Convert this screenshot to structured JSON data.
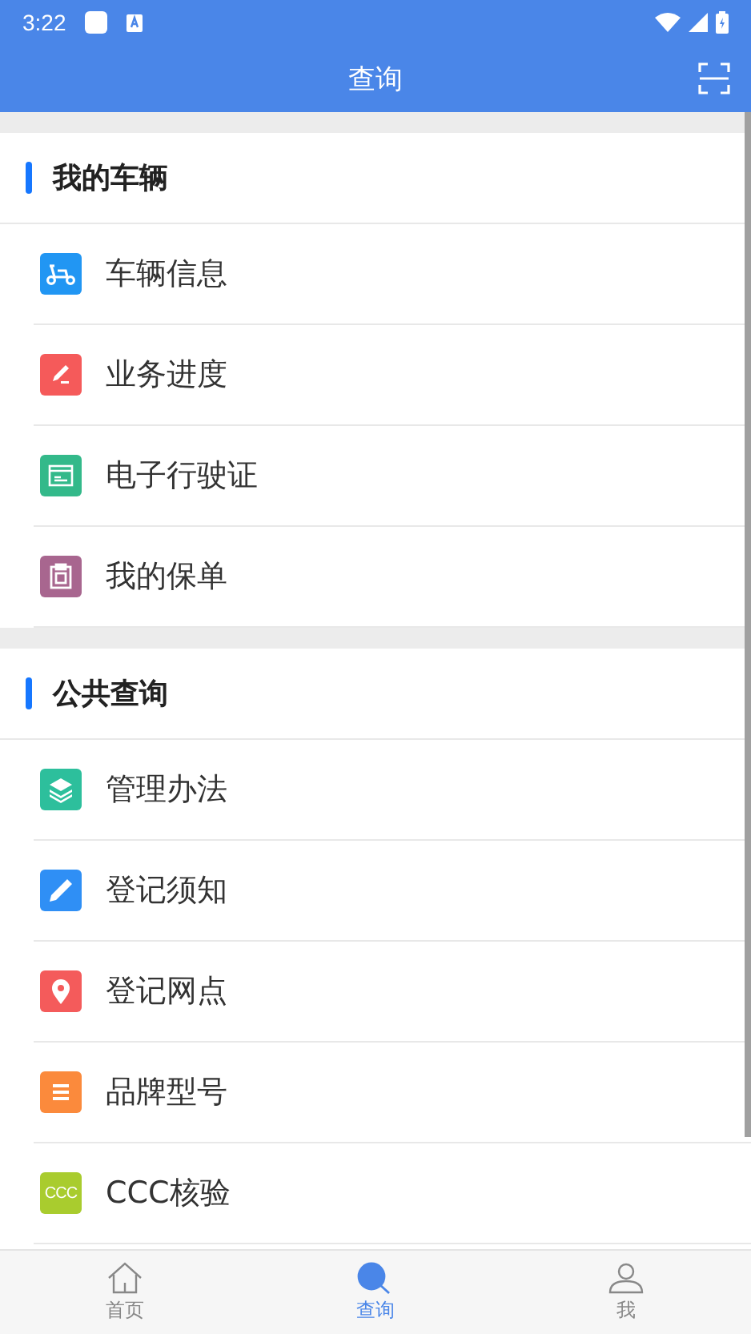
{
  "status_bar": {
    "time": "3:22"
  },
  "header": {
    "title": "查询"
  },
  "sections": [
    {
      "title": "我的车辆",
      "items": [
        {
          "label": "车辆信息",
          "kind": "scooter",
          "color": "#2196f3"
        },
        {
          "label": "业务进度",
          "kind": "pen",
          "color": "#f55a5a"
        },
        {
          "label": "电子行驶证",
          "kind": "card",
          "color": "#33b98a"
        },
        {
          "label": "我的保单",
          "kind": "clipboard",
          "color": "#a8668f"
        }
      ]
    },
    {
      "title": "公共查询",
      "items": [
        {
          "label": "管理办法",
          "kind": "layers",
          "color": "#2dbf9c"
        },
        {
          "label": "登记须知",
          "kind": "pencil",
          "color": "#2f8ff5"
        },
        {
          "label": "登记网点",
          "kind": "pin",
          "color": "#f45b5b"
        },
        {
          "label": "品牌型号",
          "kind": "list",
          "color": "#fb8a3c"
        },
        {
          "label": "CCC核验",
          "kind": "text",
          "icon_text": "CCC",
          "color": "#a9cc2e"
        }
      ]
    }
  ],
  "tabs": [
    {
      "label": "首页",
      "kind": "home",
      "selected": false
    },
    {
      "label": "查询",
      "kind": "search",
      "selected": true
    },
    {
      "label": "我",
      "kind": "user",
      "selected": false
    }
  ]
}
